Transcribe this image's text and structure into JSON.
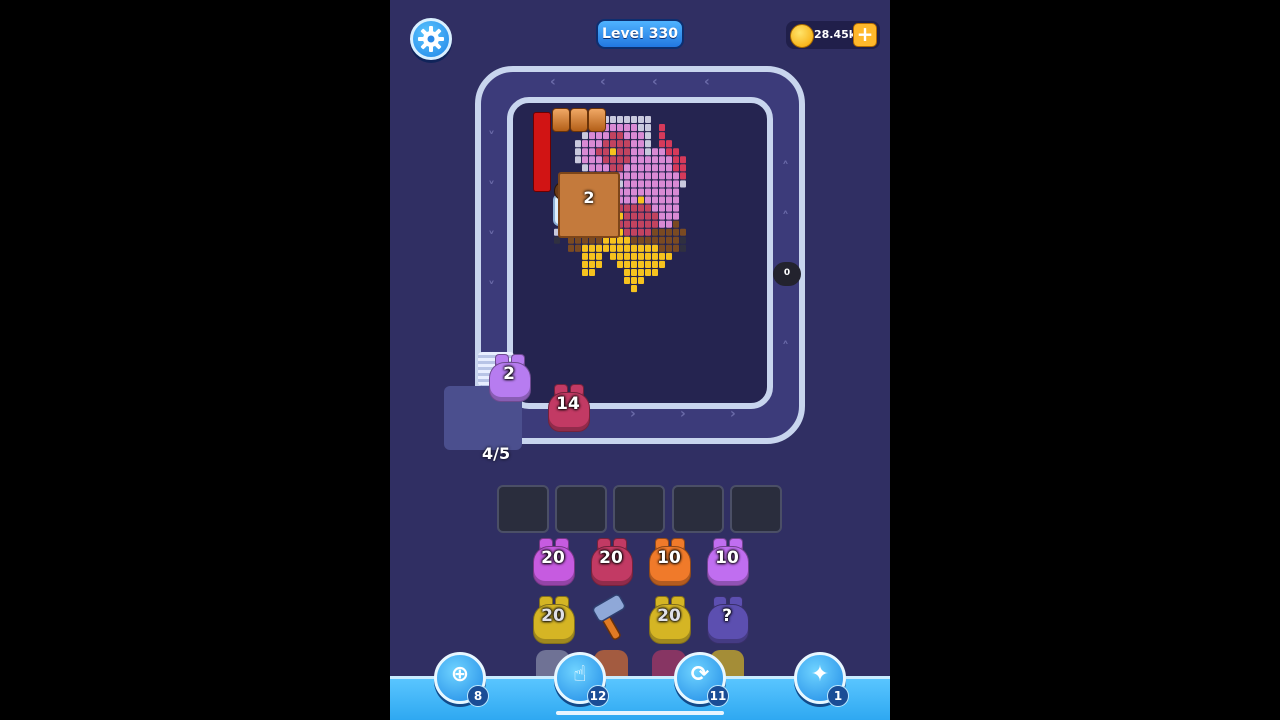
{
  "hud": {
    "level_label": "Level 330",
    "coins": "28.45k",
    "plus_symbol": "+",
    "settings_icon": "gear-icon"
  },
  "board": {
    "block_count_label": "2",
    "bomb_counter": "0"
  },
  "track": {
    "pig_on_conveyor": {
      "value": "2",
      "color": "#b77cf0"
    },
    "pig_on_track": {
      "value": "14",
      "color": "#c23a64"
    },
    "dock_progress": "4/5"
  },
  "queue": {
    "slots": [
      "",
      "",
      "",
      "",
      ""
    ]
  },
  "pig_grid": {
    "row1": [
      {
        "value": "20",
        "color": "#c65be0"
      },
      {
        "value": "20",
        "color": "#c23a64"
      },
      {
        "value": "10",
        "color": "#f07a2a"
      },
      {
        "value": "10",
        "color": "#c06ef0"
      }
    ],
    "row2": [
      {
        "value": "20",
        "color": "#f2cd1a"
      },
      {
        "value": "",
        "color": "#6f7fbf",
        "icon": "hammer-icon"
      },
      {
        "value": "20",
        "color": "#f2cd1a"
      },
      {
        "value": "?",
        "color": "#5c4fb0"
      }
    ]
  },
  "tools": [
    {
      "name": "add-slot",
      "icon": "add-card-icon",
      "glyph": "⊕",
      "count": "8"
    },
    {
      "name": "pick",
      "icon": "hand-pointer-icon",
      "glyph": "☝",
      "count": "12"
    },
    {
      "name": "shuffle",
      "icon": "shuffle-icon",
      "glyph": "⟳",
      "count": "11"
    },
    {
      "name": "magnet",
      "icon": "rocket-icon",
      "glyph": "✦",
      "count": "1"
    }
  ],
  "colors": {
    "background": "#302f63",
    "track": "#c8d5ee",
    "bottom_bar": "#2ba6f0"
  }
}
